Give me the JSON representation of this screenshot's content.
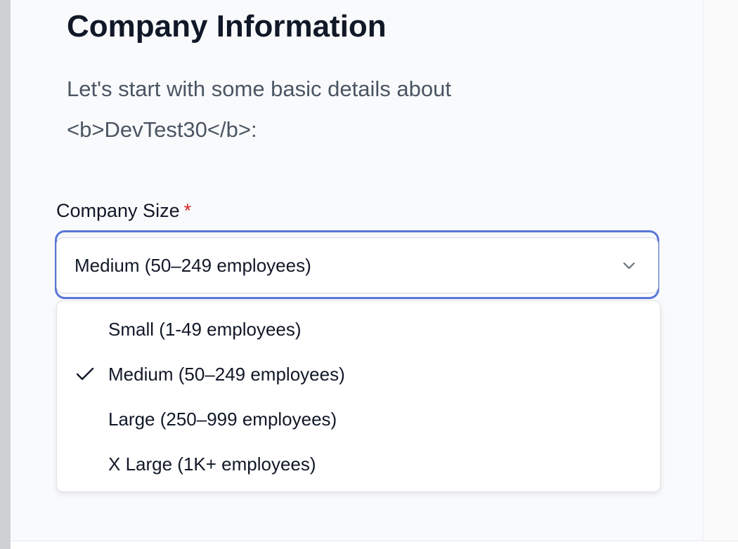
{
  "page": {
    "title": "Company Information",
    "subtitle_line1": "Let's start with some basic details about",
    "subtitle_line2": "<b>DevTest30</b>:"
  },
  "form": {
    "company_size": {
      "label": "Company Size",
      "required_marker": "*",
      "selected_value": "Medium (50–249 employees)",
      "chevron_icon": "chevron-down-icon",
      "options": [
        {
          "label": "Small (1-49 employees)",
          "selected": false
        },
        {
          "label": "Medium (50–249 employees)",
          "selected": true
        },
        {
          "label": "Large (250–999 employees)",
          "selected": false
        },
        {
          "label": "X Large (1K+ employees)",
          "selected": false
        }
      ],
      "check_icon": "check-icon"
    }
  },
  "colors": {
    "focus_ring": "#5b76d8",
    "required": "#dc2626",
    "heading": "#111827",
    "subtitle": "#4b5563",
    "panel_bg": "#f9fafc"
  }
}
